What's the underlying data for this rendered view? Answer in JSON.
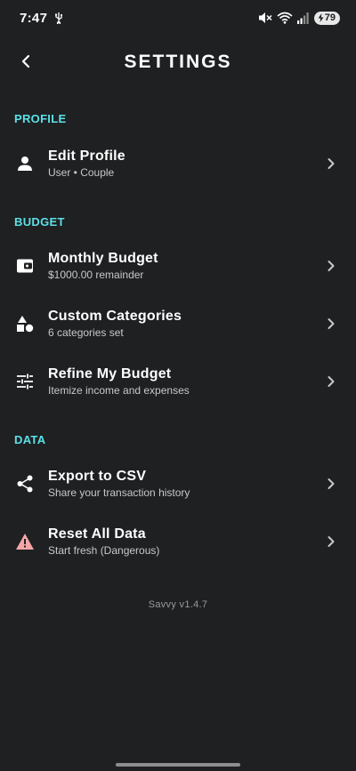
{
  "status_bar": {
    "time": "7:47",
    "battery_level": "79",
    "icons": [
      "usb-icon",
      "mute-icon",
      "wifi-icon",
      "signal-icon",
      "battery-icon"
    ]
  },
  "header": {
    "title": "SETTINGS",
    "back_icon": "back-chevron-icon"
  },
  "sections": {
    "profile": {
      "title": "PROFILE",
      "items": [
        {
          "title": "Edit Profile",
          "subtitle": "User • Couple",
          "icon": "person-icon"
        }
      ]
    },
    "budget": {
      "title": "BUDGET",
      "items": [
        {
          "title": "Monthly Budget",
          "subtitle": "$1000.00 remainder",
          "icon": "wallet-icon"
        },
        {
          "title": "Custom Categories",
          "subtitle": "6 categories set",
          "icon": "shapes-icon"
        },
        {
          "title": "Refine My Budget",
          "subtitle": "Itemize income and expenses",
          "icon": "sliders-icon"
        }
      ]
    },
    "data": {
      "title": "DATA",
      "items": [
        {
          "title": "Export to CSV",
          "subtitle": "Share your transaction history",
          "icon": "share-icon"
        },
        {
          "title": "Reset All Data",
          "subtitle": "Start fresh (Dangerous)",
          "icon": "warning-icon"
        }
      ]
    }
  },
  "footer": {
    "version": "Savvy v1.4.7"
  },
  "colors": {
    "background": "#1e2022",
    "accent": "#5ce0e6",
    "text": "#ffffff",
    "subtext": "#c8c8c8",
    "danger": "#f4a6a6"
  }
}
